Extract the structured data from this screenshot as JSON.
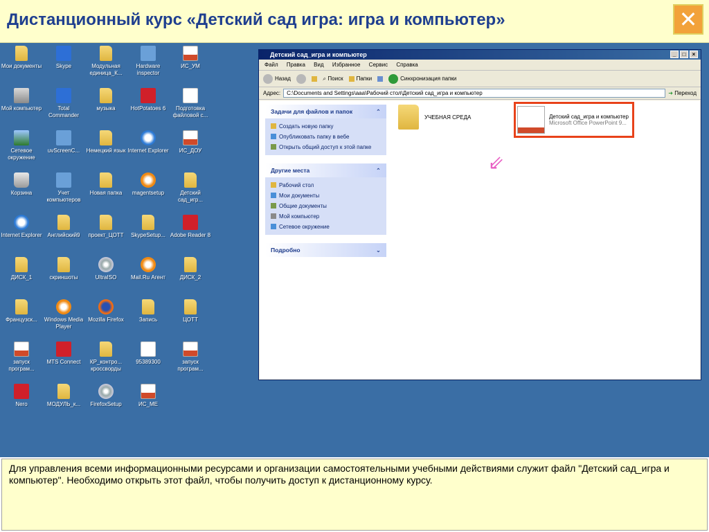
{
  "slide": {
    "title": "Дистанционный курс «Детский сад игра: игра и компьютер»",
    "close_icon": "close-icon",
    "caption": "Для управления всеми информационными ресурсами и организации самостоятельными учебными действиями служит файл \"Детский сад_игра и компьютер\". Необходимо открыть этот файл, чтобы получить доступ к дистанционному курсу."
  },
  "desktop": {
    "icons": [
      {
        "label": "Мои документы",
        "icon": "my-documents-icon"
      },
      {
        "label": "Skype",
        "icon": "skype-icon"
      },
      {
        "label": "Модульная единица_К...",
        "icon": "folder-icon"
      },
      {
        "label": "Hardware inspector",
        "icon": "hardware-inspector-icon"
      },
      {
        "label": "ИС_УМ",
        "icon": "powerpoint-icon"
      },
      {
        "label": "Мой компьютер",
        "icon": "my-computer-icon"
      },
      {
        "label": "Total Commander",
        "icon": "total-commander-icon"
      },
      {
        "label": "музыка",
        "icon": "folder-icon"
      },
      {
        "label": "HotPotatoes 6",
        "icon": "hotpotatoes-icon"
      },
      {
        "label": "Подготовка файловой с...",
        "icon": "document-icon"
      },
      {
        "label": "Сетевое окружение",
        "icon": "network-icon"
      },
      {
        "label": "uvScreenC...",
        "icon": "uvscreen-icon"
      },
      {
        "label": "Немецкий язык",
        "icon": "folder-icon"
      },
      {
        "label": "Internet Explorer",
        "icon": "internet-explorer-icon"
      },
      {
        "label": "ИС_ДОУ",
        "icon": "powerpoint-icon"
      },
      {
        "label": "Корзина",
        "icon": "recycle-bin-icon"
      },
      {
        "label": "Учет компьютеров",
        "icon": "computers-accounting-icon"
      },
      {
        "label": "Новая папка",
        "icon": "folder-icon"
      },
      {
        "label": "magentsetup",
        "icon": "magent-icon"
      },
      {
        "label": "Детский сад_игр...",
        "icon": "folder-icon"
      },
      {
        "label": "Internet Explorer",
        "icon": "internet-explorer-icon"
      },
      {
        "label": "Английский9",
        "icon": "folder-icon"
      },
      {
        "label": "проект_ЦОТТ",
        "icon": "folder-icon"
      },
      {
        "label": "SkypeSetup...",
        "icon": "skype-setup-icon"
      },
      {
        "label": "Adobe Reader 8",
        "icon": "adobe-reader-icon"
      },
      {
        "label": "ДИСК_1",
        "icon": "folder-icon"
      },
      {
        "label": "скриншоты",
        "icon": "folder-icon"
      },
      {
        "label": "UltraISO",
        "icon": "ultraiso-icon"
      },
      {
        "label": "Mail.Ru Агент",
        "icon": "mailru-agent-icon"
      },
      {
        "label": "ДИСК_2",
        "icon": "folder-icon"
      },
      {
        "label": "Французск...",
        "icon": "folder-icon"
      },
      {
        "label": "Windows Media Player",
        "icon": "windows-media-player-icon"
      },
      {
        "label": "Mozilla Firefox",
        "icon": "firefox-icon"
      },
      {
        "label": "Запись",
        "icon": "folder-icon"
      },
      {
        "label": "ЦОТТ",
        "icon": "folder-icon"
      },
      {
        "label": "запуск програм...",
        "icon": "powerpoint-icon"
      },
      {
        "label": "MTS Connect",
        "icon": "mts-connect-icon"
      },
      {
        "label": "КР_контро... кроссворды",
        "icon": "folder-icon"
      },
      {
        "label": "95389300",
        "icon": "document-icon"
      },
      {
        "label": "запуск програм...",
        "icon": "powerpoint-icon"
      },
      {
        "label": "Nero",
        "icon": "nero-icon"
      },
      {
        "label": "МОДУЛЬ_к...",
        "icon": "folder-icon"
      },
      {
        "label": "FirefoxSetup",
        "icon": "firefox-setup-icon"
      },
      {
        "label": "ИС_МЕ",
        "icon": "powerpoint-icon"
      }
    ]
  },
  "explorer": {
    "window_title": "Детский сад_игра и компьютер",
    "menu": [
      "Файл",
      "Правка",
      "Вид",
      "Избранное",
      "Сервис",
      "Справка"
    ],
    "toolbar": {
      "back": "Назад",
      "search": "Поиск",
      "folders": "Папки",
      "sync": "Синхронизация папки"
    },
    "address_label": "Адрес:",
    "address_value": "C:\\Documents and Settings\\aaa\\Рабочий стол\\Детский сад_игра и компьютер",
    "go_label": "Переход",
    "panels": [
      {
        "title": "Задачи для файлов и папок",
        "items": [
          "Создать новую папку",
          "Опубликовать папку в вебе",
          "Открыть общий доступ к этой папке"
        ]
      },
      {
        "title": "Другие места",
        "items": [
          "Рабочий стол",
          "Мои документы",
          "Общие документы",
          "Мой компьютер",
          "Сетевое окружение"
        ]
      },
      {
        "title": "Подробно",
        "items": []
      }
    ],
    "files": [
      {
        "name": "УЧЕБНАЯ СРЕДА",
        "type": ""
      },
      {
        "name": "Детский сад_игра и компьютер",
        "type": "Microsoft Office PowerPoint 9..."
      }
    ]
  }
}
